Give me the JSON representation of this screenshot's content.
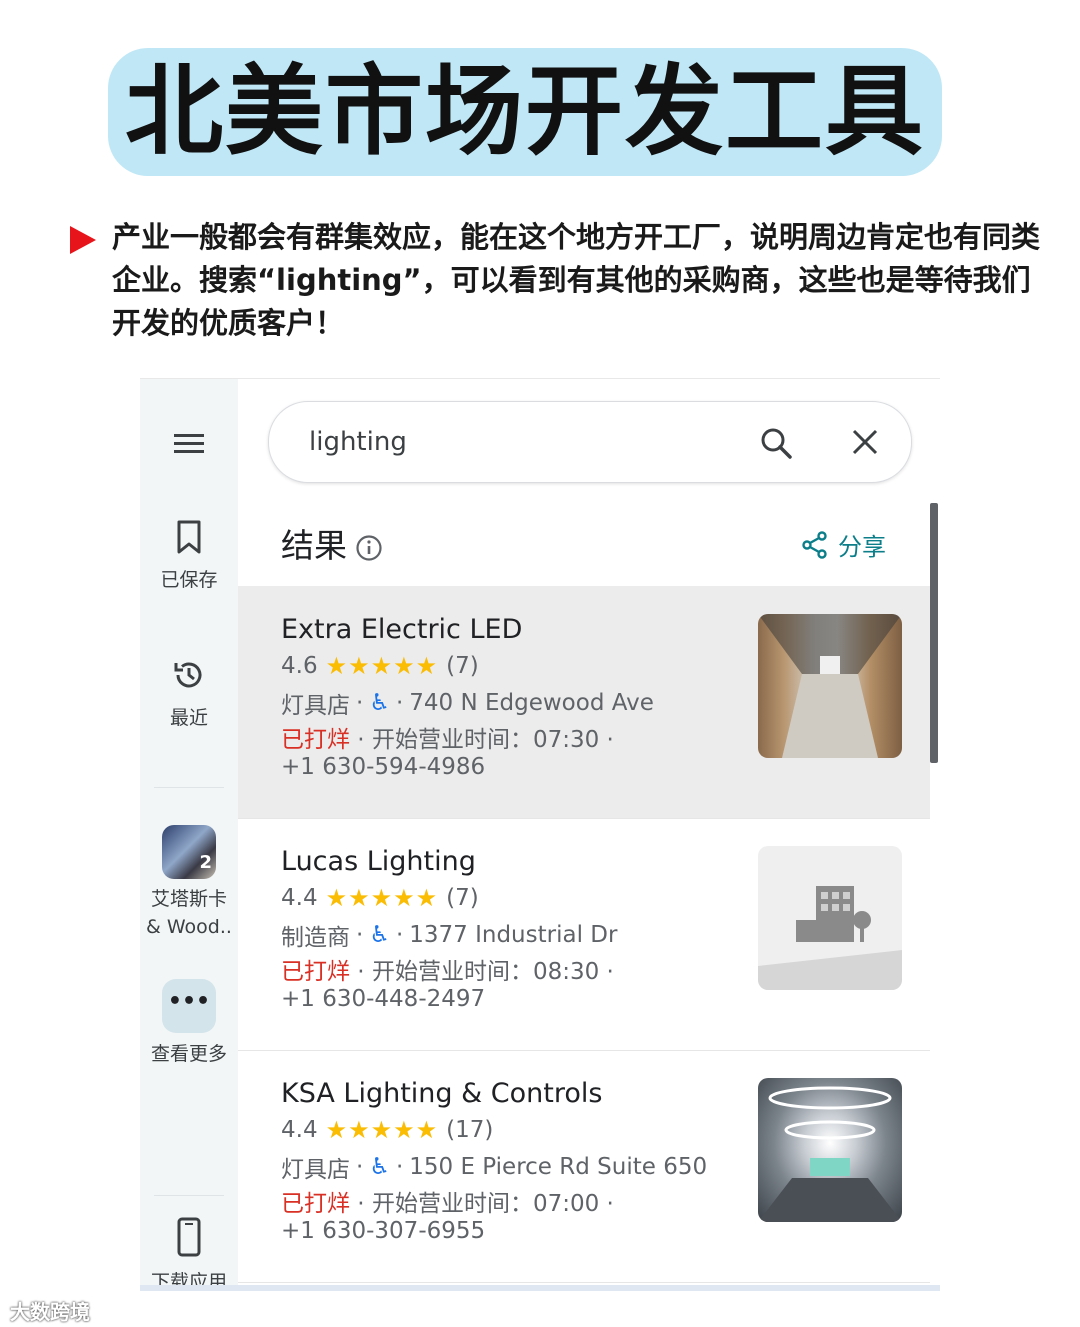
{
  "page": {
    "title": "北美市场开发工具",
    "intro": "产业一般都会有群集效应，能在这个地方开工厂，说明周边肯定也有同类企业。搜索“lighting”，可以看到有其他的采购商，这些也是等待我们开发的优质客户！",
    "watermark": "大数跨境"
  },
  "sidebar": {
    "items": [
      {
        "icon": "menu-icon",
        "label": ""
      },
      {
        "icon": "bookmark-icon",
        "label": "已保存"
      },
      {
        "icon": "history-icon",
        "label": "最近"
      },
      {
        "icon": "place-thumbnail",
        "label": "艾塔斯卡 & Wood..",
        "label_line1": "艾塔斯卡",
        "label_line2": "& Wood..",
        "badge": "2"
      },
      {
        "icon": "more-icon",
        "label": "查看更多"
      },
      {
        "icon": "phone-icon",
        "label": "下载应用"
      }
    ]
  },
  "search": {
    "query": "lighting",
    "search_icon": "search-icon",
    "clear_icon": "close-icon"
  },
  "results": {
    "heading": "结果",
    "share_label": "分享",
    "items": [
      {
        "name": "Extra Electric LED",
        "rating": "4.6",
        "stars": "★★★★★",
        "reviews": "(7)",
        "category": "灯具店",
        "address": "740 N Edgewood Ave",
        "status": "已打烊",
        "hours": "开始营业时间：07:30",
        "phone": "+1 630-594-4986",
        "photo": "warehouse"
      },
      {
        "name": "Lucas Lighting",
        "rating": "4.4",
        "stars": "★★★★★",
        "reviews": "(7)",
        "category": "制造商",
        "address": "1377 Industrial Dr",
        "status": "已打烊",
        "hours": "开始营业时间：08:30",
        "phone": "+1 630-448-2497",
        "photo": "building-placeholder"
      },
      {
        "name": "KSA Lighting & Controls",
        "rating": "4.4",
        "stars": "★★★★★",
        "reviews": "(17)",
        "category": "灯具店",
        "address": "150 E Pierce Rd Suite 650",
        "status": "已打烊",
        "hours": "开始营业时间：07:00",
        "phone": "+1 630-307-6955",
        "photo": "showroom"
      }
    ]
  },
  "colors": {
    "accent": "#1a73e8",
    "closed": "#d93025",
    "star": "#fbbc04",
    "title_bg": "#bfe7f6",
    "bullet": "#e8141b"
  }
}
